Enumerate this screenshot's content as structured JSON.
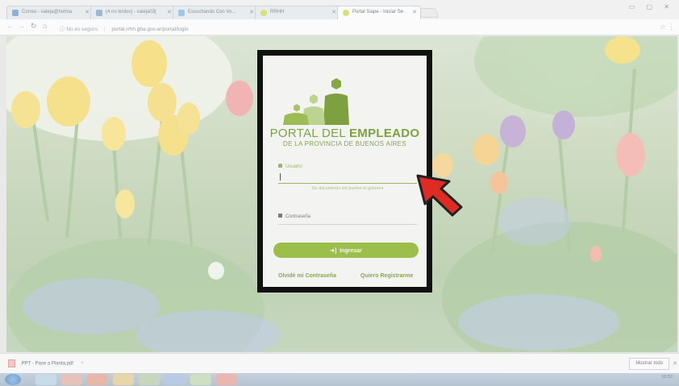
{
  "tabs": [
    {
      "title": "Correo - valeja@hotma",
      "fav": "#8fb0d8"
    },
    {
      "title": "(4 no leídos) - valeja03(",
      "fav": "#9fb7d6"
    },
    {
      "title": "Escuchando Con Vo...",
      "fav": "#9dc7e6"
    },
    {
      "title": "RRHH",
      "fav": "#d8e07a"
    },
    {
      "title": "Portal Siape - Iniciar Se",
      "fav": "#d8e07a",
      "active": true
    }
  ],
  "address": {
    "security": "No es seguro",
    "url": "portal.rrhh.gba.gov.ar/portal/login"
  },
  "login": {
    "brand_line1_light": "PORTAL DEL ",
    "brand_line1_bold": "EMPLEADO",
    "brand_line2": "DE LA PROVINCIA DE BUENOS AIRES",
    "user_label": "Usuario",
    "user_value": "",
    "user_hint": "Su documento sin puntos ni guiones",
    "password_label": "Contraseña",
    "submit_label": "Ingresar",
    "forgot_link": "Olvidé mi Contraseña",
    "register_link": "Quiero Registrarme"
  },
  "downloads": {
    "file_name": "PPT - Pase a Planta.pdf",
    "show_all": "Mostrar todo"
  },
  "taskbar": {
    "time": "16:52"
  },
  "colors": {
    "accent_green": "#9cbf4c",
    "arrow_red": "#e02a24"
  }
}
